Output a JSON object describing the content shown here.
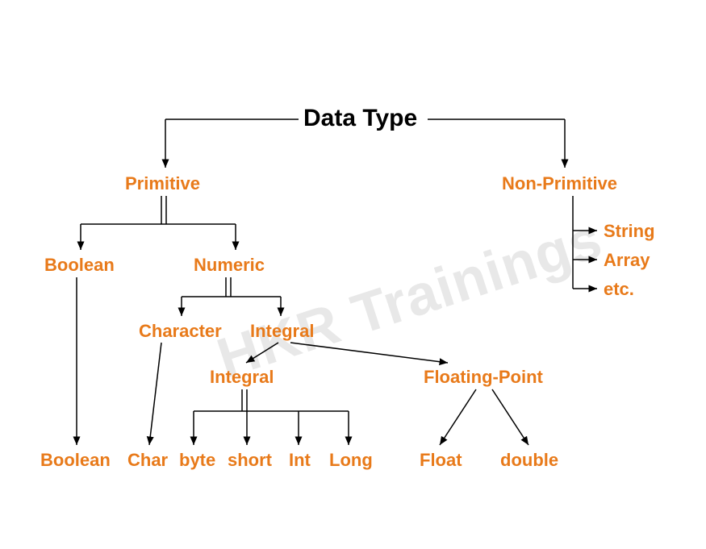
{
  "watermark": "HKR Trainings",
  "title": "Data Type",
  "nodes": {
    "primitive": "Primitive",
    "nonPrimitive": "Non-Primitive",
    "boolean1": "Boolean",
    "numeric": "Numeric",
    "string": "String",
    "array": "Array",
    "etc": "etc.",
    "character": "Character",
    "integral1": "Integral",
    "integral2": "Integral",
    "floatingPoint": "Floating-Point",
    "boolean2": "Boolean",
    "char": "Char",
    "byte": "byte",
    "short": "short",
    "int": "Int",
    "long": "Long",
    "float": "Float",
    "double": "double"
  }
}
